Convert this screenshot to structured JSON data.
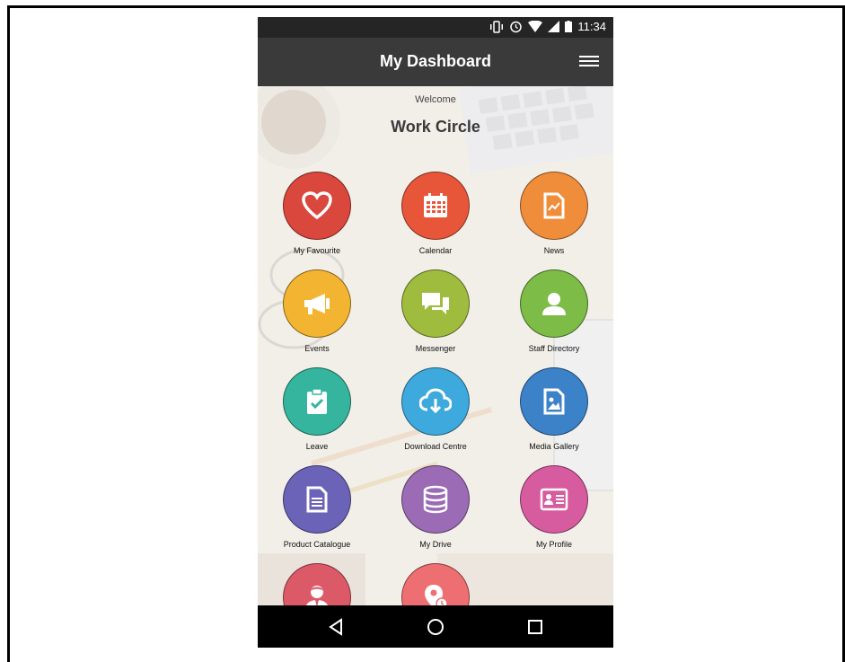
{
  "status_bar": {
    "time": "11:34"
  },
  "app_bar": {
    "title": "My Dashboard"
  },
  "header": {
    "welcome": "Welcome",
    "company": "Work Circle"
  },
  "tiles": [
    {
      "label": "My Favourite",
      "icon": "heart-icon",
      "color": "#d9473d"
    },
    {
      "label": "Calendar",
      "icon": "calendar-icon",
      "color": "#e8563a"
    },
    {
      "label": "News",
      "icon": "news-icon",
      "color": "#f08d3b"
    },
    {
      "label": "Events",
      "icon": "megaphone-icon",
      "color": "#f3b531"
    },
    {
      "label": "Messenger",
      "icon": "chat-icon",
      "color": "#9fbc3f"
    },
    {
      "label": "Staff Directory",
      "icon": "user-icon",
      "color": "#7cbc47"
    },
    {
      "label": "Leave",
      "icon": "clipboard-check-icon",
      "color": "#35b59d"
    },
    {
      "label": "Download Centre",
      "icon": "cloud-download-icon",
      "color": "#3ea9dc"
    },
    {
      "label": "Media Gallery",
      "icon": "image-file-icon",
      "color": "#3c82c9"
    },
    {
      "label": "Product Catalogue",
      "icon": "document-icon",
      "color": "#6a63b7"
    },
    {
      "label": "My Drive",
      "icon": "database-icon",
      "color": "#9b6bb5"
    },
    {
      "label": "My Profile",
      "icon": "id-card-icon",
      "color": "#d75c9f"
    },
    {
      "label": "",
      "icon": "person-icon",
      "color": "#dc5a68"
    },
    {
      "label": "",
      "icon": "location-clock-icon",
      "color": "#ee6f72"
    }
  ]
}
